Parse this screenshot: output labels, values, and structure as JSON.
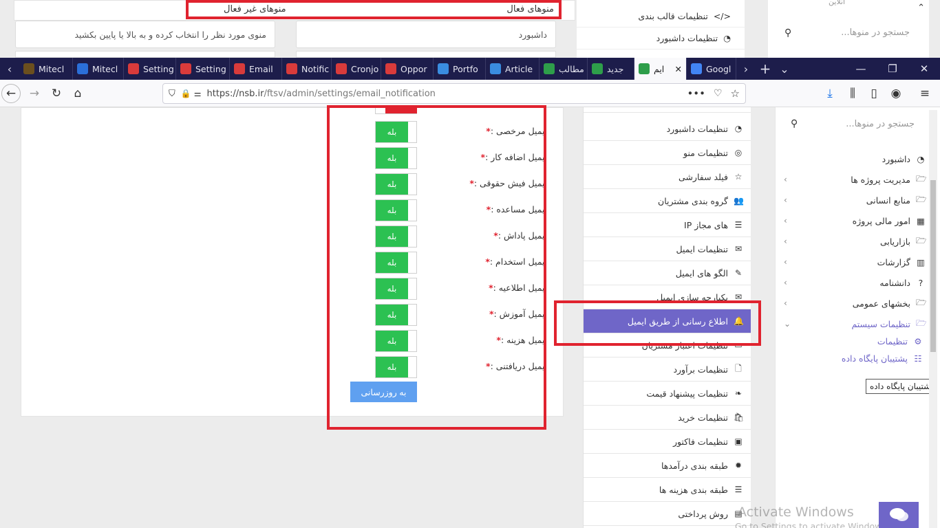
{
  "top": {
    "active_menus_label": "منوهای فعال",
    "inactive_menus_label": "منوهای غیر فعال",
    "dashboard_field": "داشبورد",
    "hint_field": "منوی مورد نظر را انتخاب کرده و به بالا یا پایین بکشید",
    "menu_items": [
      "تنظیمات قالب بندی",
      "تنظیمات داشبورد"
    ],
    "online_label": "آنلاین",
    "search_placeholder": "جستجو در منوها..."
  },
  "browser": {
    "tabs": [
      {
        "label": "Mitecl",
        "color": "#6b4f1e",
        "icon": "book-icon"
      },
      {
        "label": "Mitecl",
        "color": "#2b6fd8",
        "icon": "network-icon"
      },
      {
        "label": "Setting",
        "color": "#d93b3b",
        "icon": "form-icon"
      },
      {
        "label": "Setting",
        "color": "#d93b3b",
        "icon": "form-icon"
      },
      {
        "label": "Email",
        "color": "#d93b3b",
        "icon": "form-icon"
      },
      {
        "label": "Notific",
        "color": "#d93b3b",
        "icon": "form-icon"
      },
      {
        "label": "Cronjo",
        "color": "#d93b3b",
        "icon": "form-icon"
      },
      {
        "label": "Oppor",
        "color": "#d93b3b",
        "icon": "form-icon"
      },
      {
        "label": "Portfo",
        "color": "#3a8de0",
        "icon": "globe-icon"
      },
      {
        "label": "Article",
        "color": "#3a8de0",
        "icon": "gear-icon"
      },
      {
        "label": "مطالب",
        "color": "#2e9e4a",
        "icon": "j-icon"
      },
      {
        "label": "جدید",
        "color": "#2e9e4a",
        "icon": "j-icon"
      },
      {
        "label": "ايم",
        "color": "#2e9e4a",
        "icon": "j-icon",
        "active": true
      },
      {
        "label": "Googl",
        "color": "#4285f4",
        "icon": "google-icon"
      }
    ],
    "url_host": "https://nsb.ir",
    "url_path": "/ftsv/admin/settings/email_notification",
    "url": "https://nsb.ir/ftsv/admin/settings/email_notification"
  },
  "form": {
    "rows": [
      {
        "label": "ایمیل مرخصی :",
        "value": "بله"
      },
      {
        "label": "ایمیل اضافه کار :",
        "value": "بله"
      },
      {
        "label": "ایمیل فیش حقوقی :",
        "value": "بله"
      },
      {
        "label": "ایمیل مساعده :",
        "value": "بله"
      },
      {
        "label": "ایمیل پاداش :",
        "value": "بله"
      },
      {
        "label": "ایمیل استخدام :",
        "value": "بله"
      },
      {
        "label": "ایمیل اطلاعیه :",
        "value": "بله"
      },
      {
        "label": "ایمیل آموزش :",
        "value": "بله"
      },
      {
        "label": "ایمیل هزینه :",
        "value": "بله"
      },
      {
        "label": "ایمیل دریافتنی :",
        "value": "بله"
      }
    ],
    "required_mark": "*",
    "submit_label": "به روزرسانی"
  },
  "settings_menu": [
    {
      "label": "تنظیمات داشبورد",
      "icon": "dashboard-icon",
      "glyph": "◔"
    },
    {
      "label": "تنظیمات منو",
      "icon": "compass-icon",
      "glyph": "◎"
    },
    {
      "label": "فیلد سفارشی",
      "icon": "star-icon",
      "glyph": "☆"
    },
    {
      "label": "گروه بندی مشتریان",
      "icon": "users-icon",
      "glyph": "👥"
    },
    {
      "label": "IP های مجاز",
      "icon": "server-icon",
      "glyph": "☰"
    },
    {
      "label": "تنظیمات ایمیل",
      "icon": "envelope-icon",
      "glyph": "✉"
    },
    {
      "label": "الگو های ایمیل",
      "icon": "edit-icon",
      "glyph": "✎"
    },
    {
      "label": "یکپارچه سازی ایمیل",
      "icon": "envelope-outline-icon",
      "glyph": "✉"
    },
    {
      "label": "اطلاع رسانی از طریق ایمیل",
      "icon": "bell-icon",
      "glyph": "🔔",
      "active": true
    },
    {
      "label": "تنظیمات اعتبار مشتریان",
      "icon": "card-icon",
      "glyph": "▭"
    },
    {
      "label": "تنظیمات برآورد",
      "icon": "file-icon",
      "glyph": "🗋"
    },
    {
      "label": "تنظیمات پیشنهاد قیمت",
      "icon": "leaf-icon",
      "glyph": "❧"
    },
    {
      "label": "تنظیمات خرید",
      "icon": "shopping-bag-icon",
      "glyph": "🛍"
    },
    {
      "label": "تنظیمات فاکتور",
      "icon": "money-icon",
      "glyph": "▣"
    },
    {
      "label": "طبقه بندی درآمدها",
      "icon": "certificate-icon",
      "glyph": "✹"
    },
    {
      "label": "طبقه بندی هزینه ها",
      "icon": "list-icon",
      "glyph": "☰"
    },
    {
      "label": "روش پرداختی",
      "icon": "money-check-icon",
      "glyph": "▤"
    }
  ],
  "sidebar": {
    "search_placeholder": "جستجو در منوها...",
    "items": [
      {
        "label": "داشبورد",
        "icon": "dashboard-icon",
        "glyph": "◔",
        "chevron": false
      },
      {
        "label": "مدیریت پروژه ها",
        "icon": "folder-icon",
        "glyph": "🗁",
        "chevron": true
      },
      {
        "label": "منابع انسانی",
        "icon": "folder-icon",
        "glyph": "🗁",
        "chevron": true
      },
      {
        "label": "امور مالی پروژه",
        "icon": "ledger-icon",
        "glyph": "▦",
        "chevron": true
      },
      {
        "label": "بازاریابی",
        "icon": "folder-icon",
        "glyph": "🗁",
        "chevron": true
      },
      {
        "label": "گزارشات",
        "icon": "chart-icon",
        "glyph": "▥",
        "chevron": true
      },
      {
        "label": "دانشنامه",
        "icon": "question-icon",
        "glyph": "?",
        "chevron": true
      },
      {
        "label": "بخشهای عمومی",
        "icon": "folder-icon",
        "glyph": "🗁",
        "chevron": true
      },
      {
        "label": "تنظیمات سیستم",
        "icon": "folder-open-icon",
        "glyph": "🗁",
        "chevron": true,
        "open": true
      }
    ],
    "sub_items": [
      {
        "label": "تنظیمات",
        "icon": "cogs-icon",
        "glyph": "⚙"
      },
      {
        "label": "پشتیبان پایگاه داده",
        "icon": "database-icon",
        "glyph": "☷"
      }
    ],
    "tooltip": "پشتیبان پایگاه داده"
  },
  "watermark": {
    "title": "Activate Windows",
    "subtitle": "Go to Settings to activate Windows."
  },
  "colors": {
    "accent": "#6f66c8",
    "toggle_on": "#2cc152",
    "highlight": "#e0232f",
    "tab_bar": "#1d1d4b",
    "submit": "#5fa0f0"
  }
}
